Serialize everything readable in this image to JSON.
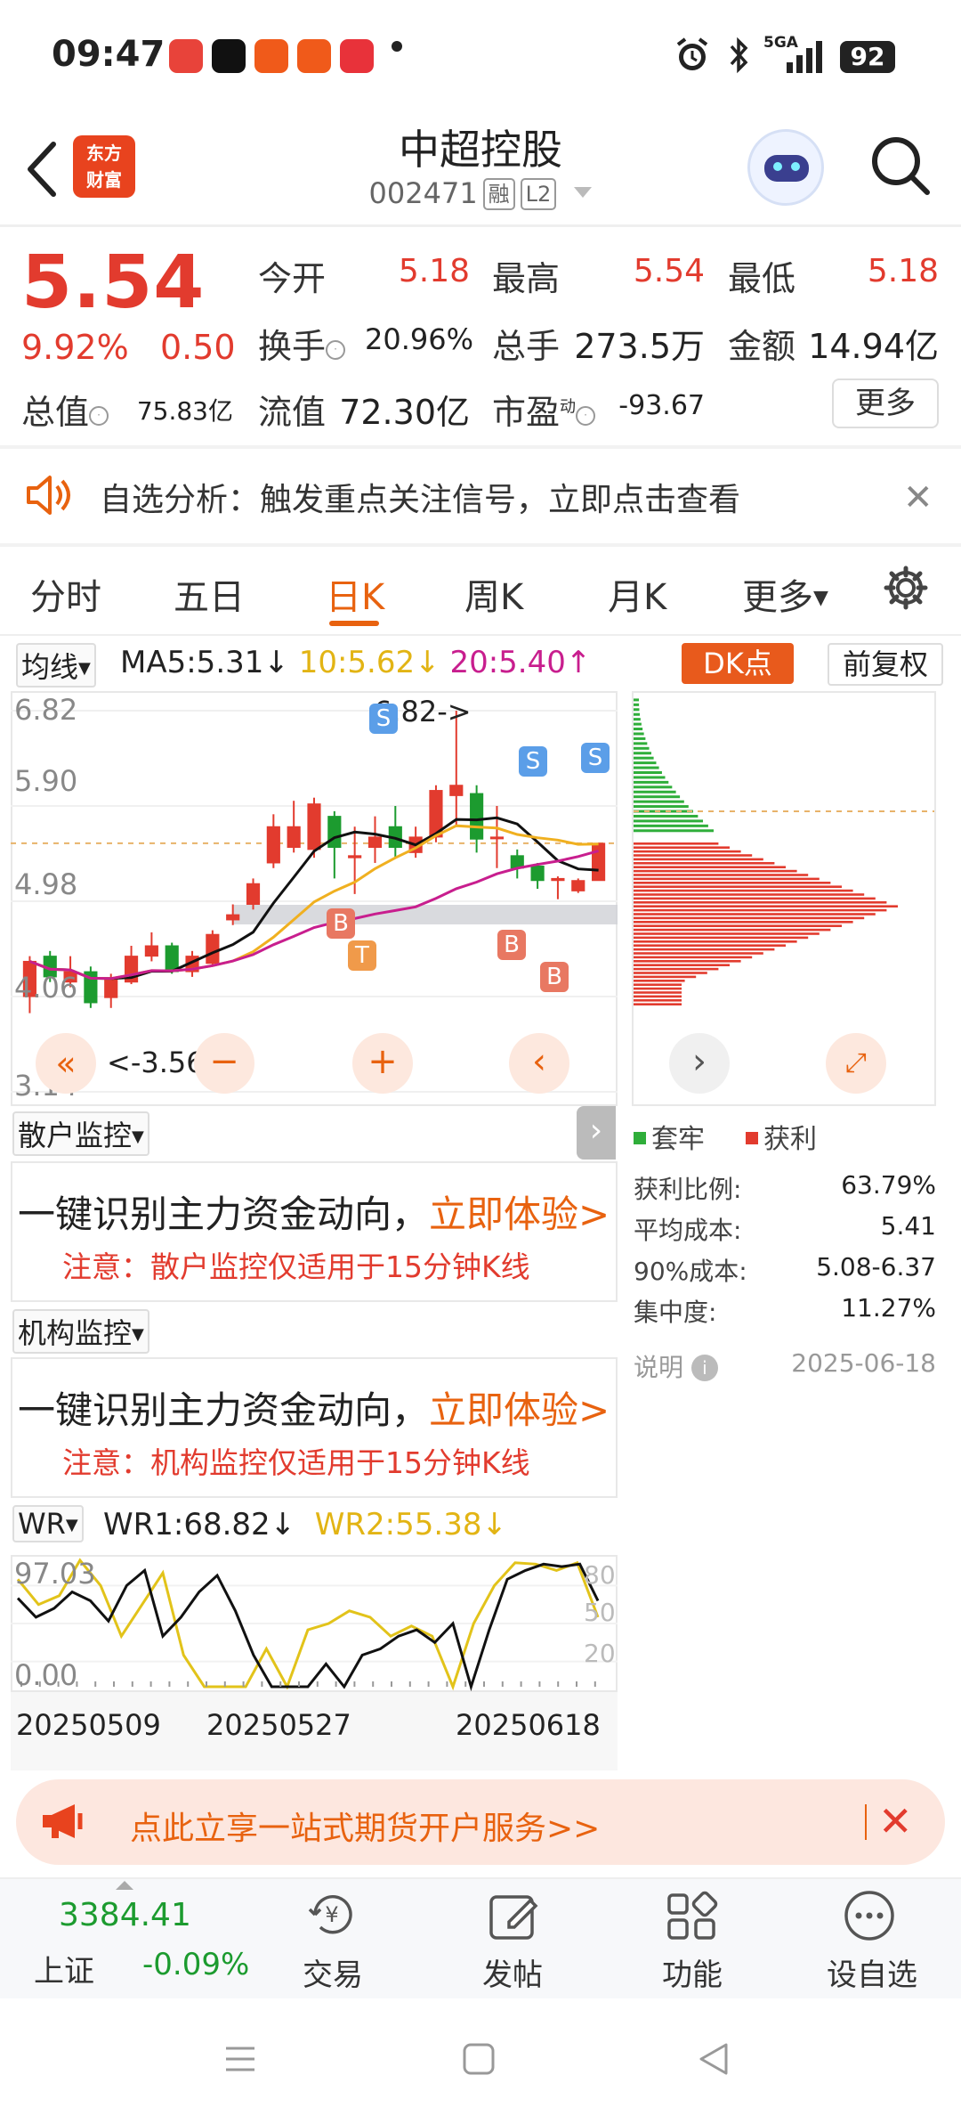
{
  "status": {
    "time": "09:47",
    "network": "5GA",
    "battery": "92",
    "app_icons": [
      "#e8433a",
      "#111111",
      "#f05a1a",
      "#f05a1a",
      "#e8323a"
    ]
  },
  "header": {
    "logo_text_1": "东方",
    "logo_text_2": "财富",
    "name": "中超控股",
    "code": "002471",
    "tag1": "融",
    "tag2": "L2"
  },
  "quote": {
    "price": "5.54",
    "pct": "9.92%",
    "change": "0.50",
    "open_label": "今开",
    "open": "5.18",
    "high_label": "最高",
    "high": "5.54",
    "low_label": "最低",
    "low": "5.18",
    "turnover_label": "换手",
    "turnover": "20.96%",
    "volume_label": "总手",
    "volume": "273.5万",
    "amount_label": "金额",
    "amount": "14.94亿",
    "mktcap_label": "总值",
    "mktcap": "75.83亿",
    "float_label": "流值",
    "float": "72.30亿",
    "pe_label": "市盈",
    "pe_sup": "动",
    "pe": "-93.67",
    "more": "更多"
  },
  "alert": {
    "text": "自选分析：触发重点关注信号，立即点击查看"
  },
  "tabs": [
    "分时",
    "五日",
    "日K",
    "周K",
    "月K",
    "更多"
  ],
  "active_tab": "日K",
  "ma": {
    "selector": "均线",
    "ma5": "MA5:5.31",
    "ma10": "10:5.62",
    "ma20": "20:5.40",
    "dk": "DK点",
    "adjust": "前复权"
  },
  "kchart": {
    "y_labels": [
      "6.82",
      "5.90",
      "4.98",
      "4.06",
      "3.14"
    ],
    "high_label": "6.82->",
    "low_label": "<-3.56",
    "markers": [
      "S",
      "S",
      "S",
      "B",
      "T",
      "B",
      "B"
    ],
    "colors": {
      "up": "#e23b2e",
      "down": "#1c9b2f",
      "ma5": "#111111",
      "ma10": "#f0b020",
      "ma20": "#c81e8e"
    }
  },
  "kchart_candles": [
    {
      "o": 4.06,
      "c": 4.4,
      "h": 4.45,
      "l": 3.9
    },
    {
      "o": 4.45,
      "c": 4.25,
      "h": 4.5,
      "l": 4.2
    },
    {
      "o": 4.2,
      "c": 4.3,
      "h": 4.45,
      "l": 4.15
    },
    {
      "o": 4.3,
      "c": 4.0,
      "h": 4.35,
      "l": 3.95
    },
    {
      "o": 4.05,
      "c": 4.22,
      "h": 4.28,
      "l": 3.95
    },
    {
      "o": 4.2,
      "c": 4.45,
      "h": 4.55,
      "l": 4.18
    },
    {
      "o": 4.45,
      "c": 4.55,
      "h": 4.68,
      "l": 4.4
    },
    {
      "o": 4.55,
      "c": 4.3,
      "h": 4.58,
      "l": 4.28
    },
    {
      "o": 4.3,
      "c": 4.45,
      "h": 4.5,
      "l": 4.25
    },
    {
      "o": 4.38,
      "c": 4.66,
      "h": 4.7,
      "l": 4.35
    },
    {
      "o": 4.8,
      "c": 4.85,
      "h": 4.95,
      "l": 4.75
    },
    {
      "o": 4.95,
      "c": 5.15,
      "h": 5.2,
      "l": 4.9
    },
    {
      "o": 5.35,
      "c": 5.7,
      "h": 5.82,
      "l": 5.3
    },
    {
      "o": 5.5,
      "c": 5.7,
      "h": 5.95,
      "l": 5.45
    },
    {
      "o": 5.48,
      "c": 5.92,
      "h": 5.98,
      "l": 5.4
    },
    {
      "o": 5.8,
      "c": 5.5,
      "h": 5.85,
      "l": 5.2
    },
    {
      "o": 5.4,
      "c": 5.42,
      "h": 5.7,
      "l": 5.05
    },
    {
      "o": 5.5,
      "c": 5.6,
      "h": 5.8,
      "l": 5.35
    },
    {
      "o": 5.7,
      "c": 5.5,
      "h": 5.9,
      "l": 5.4
    },
    {
      "o": 5.45,
      "c": 5.6,
      "h": 5.7,
      "l": 5.4
    },
    {
      "o": 5.6,
      "c": 6.05,
      "h": 6.1,
      "l": 5.55
    },
    {
      "o": 6.0,
      "c": 6.1,
      "h": 6.82,
      "l": 5.7
    },
    {
      "o": 6.02,
      "c": 5.58,
      "h": 6.1,
      "l": 5.45
    },
    {
      "o": 5.6,
      "c": 5.6,
      "h": 5.9,
      "l": 5.3
    },
    {
      "o": 5.42,
      "c": 5.3,
      "h": 5.48,
      "l": 5.2
    },
    {
      "o": 5.32,
      "c": 5.18,
      "h": 5.35,
      "l": 5.1
    },
    {
      "o": 5.18,
      "c": 5.2,
      "h": 5.22,
      "l": 5.0
    },
    {
      "o": 5.08,
      "c": 5.18,
      "h": 5.2,
      "l": 5.06
    },
    {
      "o": 5.18,
      "c": 5.54,
      "h": 5.54,
      "l": 5.18
    }
  ],
  "cost": {
    "legend_trapped": "套牢",
    "legend_profit": "获利",
    "rows": [
      {
        "label": "获利比例:",
        "value": "63.79%"
      },
      {
        "label": "平均成本:",
        "value": "5.41"
      },
      {
        "label": "90%成本:",
        "value": "5.08-6.37"
      },
      {
        "label": "集中度:",
        "value": "11.27%"
      }
    ],
    "note": "说明",
    "date": "2025-06-18"
  },
  "retail": {
    "selector": "散户监控",
    "line1": "一键识别主力资金动向，",
    "cta": "立即体验>",
    "note": "注意：散户监控仅适用于15分钟K线"
  },
  "inst": {
    "selector": "机构监控",
    "line1": "一键识别主力资金动向，",
    "cta": "立即体验>",
    "note": "注意：机构监控仅适用于15分钟K线"
  },
  "wr": {
    "selector": "WR",
    "wr1": "WR1:68.82",
    "wr2": "WR2:55.38",
    "y_top": "97.03",
    "y_bottom": "0.00",
    "right_labels": [
      "80",
      "50",
      "20"
    ],
    "dates": [
      "20250509",
      "20250527",
      "20250618"
    ],
    "wr1_values": [
      70,
      55,
      62,
      75,
      68,
      52,
      80,
      92,
      40,
      55,
      75,
      88,
      60,
      25,
      0,
      0,
      0,
      18,
      0,
      25,
      30,
      40,
      45,
      35,
      50,
      0,
      45,
      85,
      92,
      97,
      95,
      97,
      68
    ],
    "wr2_values": [
      85,
      65,
      72,
      100,
      80,
      40,
      65,
      90,
      25,
      0,
      0,
      0,
      30,
      0,
      45,
      50,
      60,
      55,
      40,
      48,
      40,
      0,
      50,
      80,
      98,
      97,
      92,
      98,
      55
    ]
  },
  "ad": {
    "text": "点此立享一站式期货开户服务>>"
  },
  "bottom_nav": {
    "index_value": "3384.41",
    "index_name": "上证",
    "index_change": "-0.09%",
    "items": [
      "交易",
      "发帖",
      "功能",
      "设自选"
    ]
  }
}
